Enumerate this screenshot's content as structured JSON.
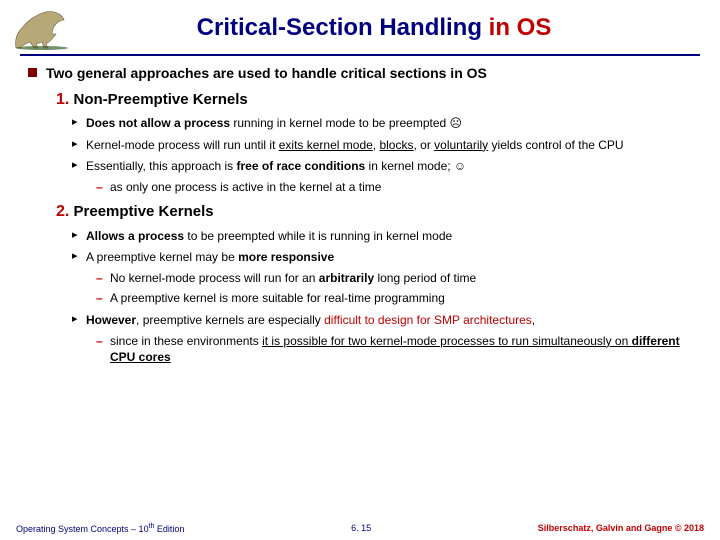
{
  "title": {
    "main": "Critical-Section Handling ",
    "accent": "in OS"
  },
  "intro": "Two general approaches are used to handle critical sections in OS",
  "sec1": {
    "num": "1.",
    "heading": "Non-Preemptive Kernels",
    "b1_pre": "Does not allow a process",
    "b1_rest": " running in kernel mode to be preempted ☹",
    "b2_a": "Kernel-mode process will run until it ",
    "b2_u1": "exits kernel mode",
    "b2_b": ", ",
    "b2_u2": "blocks",
    "b2_c": ", or ",
    "b2_u3": "voluntarily",
    "b2_d": " yields control of the CPU",
    "b3_a": "Essentially, this approach is ",
    "b3_bold": "free of race conditions",
    "b3_b": " in kernel mode; ☺",
    "b3_dash": "as only one process is active in the kernel at a time"
  },
  "sec2": {
    "num": "2.",
    "heading": "Preemptive Kernels",
    "b1_bold": "Allows a process",
    "b1_rest": " to be preempted while it is running in kernel mode",
    "b2_a": "A preemptive kernel may be ",
    "b2_bold": "more responsive",
    "b2_d1_a": "No kernel-mode process will run for an ",
    "b2_d1_bold": "arbitrarily",
    "b2_d1_b": " long period of time",
    "b2_d2": "A preemptive kernel is more suitable for real-time programming",
    "b3_bold": "However",
    "b3_a": ", preemptive kernels are especially ",
    "b3_red": "difficult to design for SMP architectures",
    "b3_b": ",",
    "b3_d_a": "since in these environments ",
    "b3_d_u": "it is possible for two kernel-mode processes to run simultaneously on ",
    "b3_d_bold": "different CPU cores"
  },
  "footer": {
    "left_a": "Operating System Concepts – 10",
    "left_sup": "th",
    "left_b": " Edition",
    "center": "6. 15",
    "right": "Silberschatz, Galvin and Gagne © 2018"
  }
}
